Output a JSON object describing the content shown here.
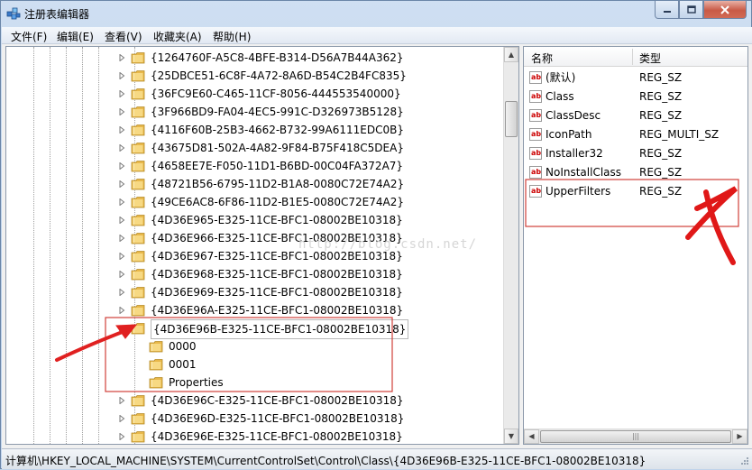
{
  "window": {
    "title": "注册表编辑器"
  },
  "menu": [
    "文件(F)",
    "编辑(E)",
    "查看(V)",
    "收藏夹(A)",
    "帮助(H)"
  ],
  "tree": {
    "items": [
      {
        "label": "{1264760F-A5C8-4BFE-B314-D56A7B44A362}",
        "level": 0
      },
      {
        "label": "{25DBCE51-6C8F-4A72-8A6D-B54C2B4FC835}",
        "level": 0
      },
      {
        "label": "{36FC9E60-C465-11CF-8056-444553540000}",
        "level": 0
      },
      {
        "label": "{3F966BD9-FA04-4EC5-991C-D326973B5128}",
        "level": 0
      },
      {
        "label": "{4116F60B-25B3-4662-B732-99A6111EDC0B}",
        "level": 0
      },
      {
        "label": "{43675D81-502A-4A82-9F84-B75F418C5DEA}",
        "level": 0
      },
      {
        "label": "{4658EE7E-F050-11D1-B6BD-00C04FA372A7}",
        "level": 0
      },
      {
        "label": "{48721B56-6795-11D2-B1A8-0080C72E74A2}",
        "level": 0
      },
      {
        "label": "{49CE6AC8-6F86-11D2-B1E5-0080C72E74A2}",
        "level": 0
      },
      {
        "label": "{4D36E965-E325-11CE-BFC1-08002BE10318}",
        "level": 0
      },
      {
        "label": "{4D36E966-E325-11CE-BFC1-08002BE10318}",
        "level": 0
      },
      {
        "label": "{4D36E967-E325-11CE-BFC1-08002BE10318}",
        "level": 0
      },
      {
        "label": "{4D36E968-E325-11CE-BFC1-08002BE10318}",
        "level": 0
      },
      {
        "label": "{4D36E969-E325-11CE-BFC1-08002BE10318}",
        "level": 0
      },
      {
        "label": "{4D36E96A-E325-11CE-BFC1-08002BE10318}",
        "level": 0
      },
      {
        "label": "{4D36E96B-E325-11CE-BFC1-08002BE10318}",
        "level": 0,
        "expanded": true,
        "selected": true
      },
      {
        "label": "0000",
        "level": 1
      },
      {
        "label": "0001",
        "level": 1
      },
      {
        "label": "Properties",
        "level": 1
      },
      {
        "label": "{4D36E96C-E325-11CE-BFC1-08002BE10318}",
        "level": 0
      },
      {
        "label": "{4D36E96D-E325-11CE-BFC1-08002BE10318}",
        "level": 0
      },
      {
        "label": "{4D36E96E-E325-11CE-BFC1-08002BE10318}",
        "level": 0
      }
    ]
  },
  "values": {
    "headers": {
      "name": "名称",
      "type": "类型"
    },
    "rows": [
      {
        "name": "(默认)",
        "type": "REG_SZ"
      },
      {
        "name": "Class",
        "type": "REG_SZ"
      },
      {
        "name": "ClassDesc",
        "type": "REG_SZ"
      },
      {
        "name": "IconPath",
        "type": "REG_MULTI_SZ"
      },
      {
        "name": "Installer32",
        "type": "REG_SZ"
      },
      {
        "name": "NoInstallClass",
        "type": "REG_SZ"
      },
      {
        "name": "UpperFilters",
        "type": "REG_SZ"
      }
    ]
  },
  "status": {
    "path": "计算机\\HKEY_LOCAL_MACHINE\\SYSTEM\\CurrentControlSet\\Control\\Class\\{4D36E96B-E325-11CE-BFC1-08002BE10318}"
  },
  "watermark": "http://blog.csdn.net/",
  "colors": {
    "annotation": "#e02020",
    "folder": "#f2cf6a",
    "selection_border": "#d0403a"
  }
}
